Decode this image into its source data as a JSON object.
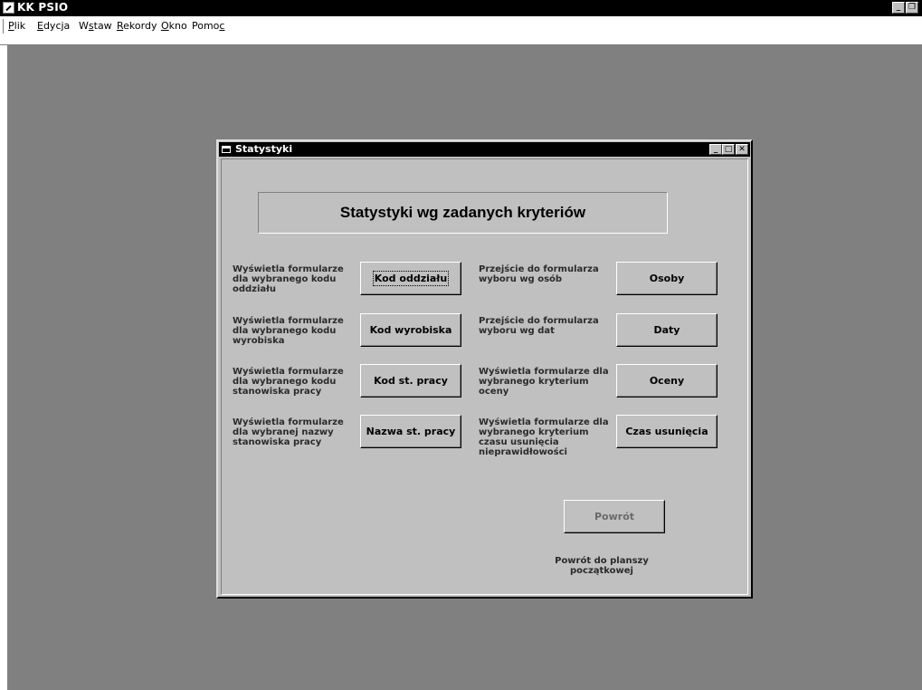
{
  "app": {
    "title": "KK PSIO"
  },
  "menu": [
    {
      "label": "Plik",
      "accel": "P",
      "rest": "lik"
    },
    {
      "label": "Edycja",
      "accel": "E",
      "rest": "dycja"
    },
    {
      "label": "Wstaw",
      "pre": "W",
      "accel": "s",
      "rest": "taw"
    },
    {
      "label": "Rekordy",
      "accel": "R",
      "rest": "ekordy"
    },
    {
      "label": "Okno",
      "accel": "O",
      "rest": "kno"
    },
    {
      "label": "Pomoc",
      "pre": "Pomo",
      "accel": "c",
      "rest": ""
    }
  ],
  "dialog": {
    "title": "Statystyki",
    "heading": "Statystyki wg zadanych kryteriów",
    "left": [
      {
        "desc": "Wyświetla formularze dla wybranego kodu oddziału",
        "button": "Kod oddziału"
      },
      {
        "desc": "Wyświetla formularze dla wybranego kodu wyrobiska",
        "button": "Kod wyrobiska"
      },
      {
        "desc": "Wyświetla formularze dla wybranego kodu stanowiska pracy",
        "button": "Kod st. pracy"
      },
      {
        "desc": "Wyświetla formularze dla wybranej nazwy stanowiska pracy",
        "button": "Nazwa st. pracy"
      }
    ],
    "right": [
      {
        "desc": "Przejście do formularza wyboru wg osób",
        "button": "Osoby"
      },
      {
        "desc": "Przejście do formularza wyboru wg dat",
        "button": "Daty"
      },
      {
        "desc": "Wyświetla formularze dla wybranego kryterium oceny",
        "button": "Oceny"
      },
      {
        "desc": "Wyświetla formularze dla wybranego kryterium czasu usunięcia nieprawidłowości",
        "button": "Czas usunięcia"
      }
    ],
    "back": {
      "button": "Powrót",
      "caption": "Powrót do planszy początkowej"
    }
  },
  "colors": {
    "workspace": "#808080",
    "dialog": "#c0c0c0",
    "titlebar": "#000000"
  },
  "icons": {
    "app": "pen-icon",
    "dialog": "form-icon"
  }
}
